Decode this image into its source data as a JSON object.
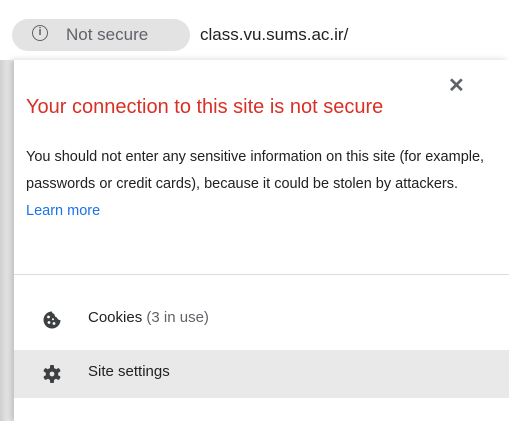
{
  "omnibox": {
    "security_label": "Not secure",
    "url": "class.vu.sums.ac.ir/",
    "info_icon": "info-icon"
  },
  "popup": {
    "headline": "Your connection to this site is not secure",
    "description": "You should not enter any sensitive information on this site (for example, passwords or credit cards), because it could be stolen by attackers.",
    "learn_more": "Learn more",
    "close_icon": "close-icon",
    "rows": [
      {
        "label": "Cookies",
        "count": "(3 in use)",
        "icon": "cookie-icon"
      },
      {
        "label": "Site settings",
        "icon": "gear-icon"
      }
    ]
  },
  "colors": {
    "warning": "#d93025",
    "link": "#1a73e8",
    "chip_bg": "#e3e3e3",
    "hover_row": "#e9e9e9"
  }
}
